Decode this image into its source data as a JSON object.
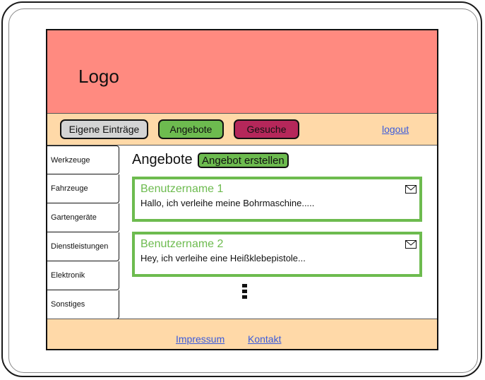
{
  "header": {
    "logo": "Logo"
  },
  "nav": {
    "buttons": [
      {
        "label": "Eigene Einträge",
        "color": "#d4d4d4"
      },
      {
        "label": "Angebote",
        "color": "#6dbb4f"
      },
      {
        "label": "Gesuche",
        "color": "#b5275a"
      }
    ],
    "logout": "logout"
  },
  "sidebar": {
    "items": [
      {
        "label": "Werkzeuge"
      },
      {
        "label": "Fahrzeuge"
      },
      {
        "label": "Gartengeräte"
      },
      {
        "label": "Dienstleistungen"
      },
      {
        "label": "Elektronik"
      },
      {
        "label": "Sonstiges"
      }
    ]
  },
  "main": {
    "title": "Angebote",
    "create_button": "Angebot erstellen",
    "posts": [
      {
        "user": "Benutzername 1",
        "text": "Hallo, ich verleihe meine Bohrmaschine....."
      },
      {
        "user": "Benutzername 2",
        "text": "Hey, ich verleihe eine Heißklebepistole..."
      }
    ]
  },
  "footer": {
    "impressum": "Impressum",
    "kontakt": "Kontakt"
  },
  "colors": {
    "header_bg": "#ff8a80",
    "nav_bg": "#ffd9a8",
    "accent_green": "#6dbb4f",
    "gesuche": "#b5275a",
    "link": "#3b5bdb"
  },
  "icons": {
    "mail": "envelope-icon",
    "more": "vertical-ellipsis-icon"
  }
}
